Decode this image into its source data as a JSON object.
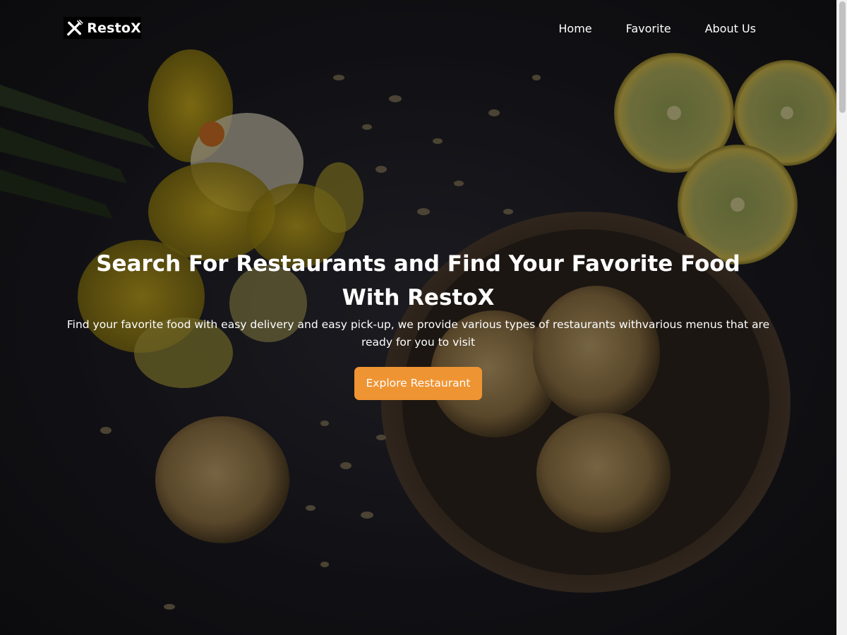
{
  "brand": {
    "name": "RestoX",
    "icon": "fork-knife-icon"
  },
  "nav": {
    "items": [
      "Home",
      "Favorite",
      "About Us"
    ]
  },
  "hero": {
    "title": "Search For Restaurants and Find Your Favorite Food With RestoX",
    "subtitle": "Find your favorite food with easy delivery and easy pick-up, we provide various types of restaurants withvarious menus that are ready for you to visit",
    "cta_label": "Explore Restaurant"
  },
  "colors": {
    "accent": "#ef9433",
    "text": "#ffffff",
    "overlay": "#000000"
  },
  "scrollbar": {
    "position_fraction": 0.0
  }
}
